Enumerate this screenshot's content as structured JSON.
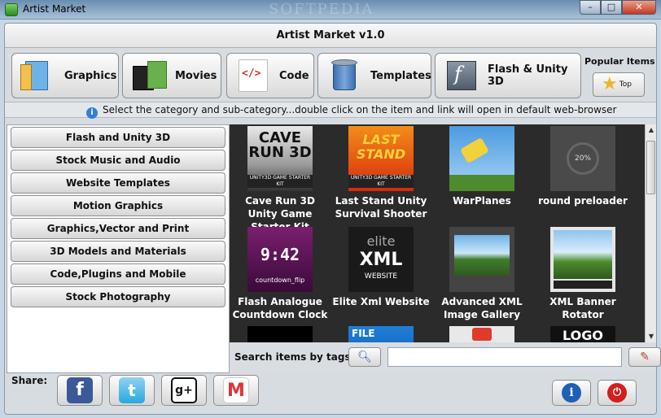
{
  "window": {
    "title": "Artist Market",
    "watermark": "SOFTPEDIA",
    "buttons": {
      "minimize": "–",
      "maximize": "□",
      "close": "✕"
    }
  },
  "header": {
    "title": "Artist Market v1.0"
  },
  "categories": [
    {
      "label": "Graphics",
      "icon": "graphics-icon"
    },
    {
      "label": "Movies",
      "icon": "film-icon"
    },
    {
      "label": "Code",
      "icon": "code-icon"
    },
    {
      "label": "Templates",
      "icon": "paint-can-icon"
    },
    {
      "label": "Flash & Unity 3D",
      "icon": "flash-icon"
    }
  ],
  "popular": {
    "label": "Popular Items",
    "top_label": "Top"
  },
  "info": {
    "text": "Select the category and sub-category...double click on the item and link will open in default web-browser"
  },
  "sidebar": {
    "items": [
      "Flash and Unity 3D",
      "Stock Music and Audio",
      "Website Templates",
      "Motion Graphics",
      "Graphics,Vector and Print",
      "3D Models and Materials",
      "Code,Plugins and Mobile",
      "Stock Photography"
    ]
  },
  "grid": {
    "items": [
      {
        "caption": "Cave Run 3D Unity Game Starter Kit",
        "thumb_text": "CAVE RUN 3D",
        "thumb_sub": "UNITY3D GAME STARTER KIT"
      },
      {
        "caption": "Last Stand Unity Survival Shooter",
        "thumb_text": "LAST STAND",
        "thumb_sub": "UNITY3D GAME STARTER KIT"
      },
      {
        "caption": "WarPlanes"
      },
      {
        "caption": "round preloader",
        "thumb_text": "20%"
      },
      {
        "caption": "Flash Analogue Countdown Clock",
        "thumb_text": "9:42",
        "thumb_sub": "countdown_flip"
      },
      {
        "caption": "Elite Xml Website",
        "thumb_l1": "elite",
        "thumb_l2": "XML",
        "thumb_l3": "WEBSITE"
      },
      {
        "caption": "Advanced XML Image Gallery"
      },
      {
        "caption": "XML Banner Rotator"
      },
      {
        "caption": ""
      },
      {
        "caption": "",
        "thumb_text": "FILE"
      },
      {
        "caption": ""
      },
      {
        "caption": "",
        "thumb_text": "LOGO"
      }
    ]
  },
  "search": {
    "label": "Search items by tags",
    "value": "",
    "placeholder": ""
  },
  "share": {
    "label": "Share:"
  },
  "social_icons": {
    "facebook": "f",
    "twitter": "t",
    "google_plus": "g+",
    "gmail": "M"
  },
  "bottom": {
    "info_glyph": "i",
    "power_glyph": "⏻"
  }
}
